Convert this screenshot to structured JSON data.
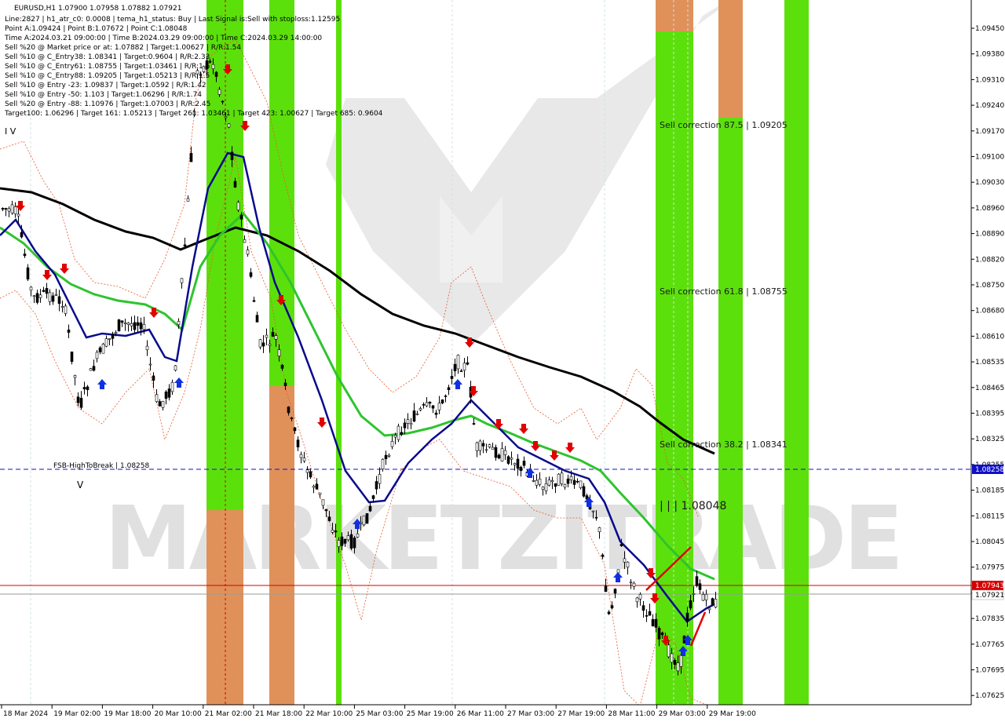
{
  "chart_data": {
    "type": "candlestick",
    "symbol_line": "EURUSD,H1  1.07900 1.07958 1.07882 1.07921",
    "info_lines": [
      "Line:2827  |  h1_atr_c0: 0.0008  |  tema_h1_status: Buy  |  Last Signal is:Sell with stoploss:1.12595",
      "Point A:1.09424  |  Point B:1.07672  |  Point C:1.08048",
      "Time A:2024.03.21 09:00:00  |  Time B:2024.03.29 09:00:00  |  Time C:2024.03.29 14:00:00",
      "Sell %20 @ Market price or at: 1.07882  |  Target:1.00627  |  R/R:1.54",
      "Sell %10 @ C_Entry38: 1.08341  |  Target:0.9604  |  R/R:2.33",
      "Sell %10 @ C_Entry61: 1.08755  |  Target:1.03461  |  R/R:1.6",
      "Sell %10 @ C_Entry88: 1.09205  |  Target:1.05213  |  R/R:1.5",
      "Sell %10 @ Entry -23: 1.09837  |  Target:1.0592  |  R/R:1.42",
      "Sell %10 @ Entry -50: 1.103  |  Target:1.06296  |  R/R:1.74",
      "Sell %20 @ Entry -88: 1.10976  |  Target:1.07003  |  R/R:2.45",
      "Target100: 1.06296  |  Target 161: 1.05213  |  Target 261: 1.03461  |  Target 423: 1.00627  |  Target 685: 0.9604"
    ],
    "y_ticks": [
      "1.09450",
      "1.09380",
      "1.09310",
      "1.09240",
      "1.09170",
      "1.09100",
      "1.09030",
      "1.08960",
      "1.08890",
      "1.08820",
      "1.08750",
      "1.08680",
      "1.08610",
      "1.08535",
      "1.08465",
      "1.08395",
      "1.08325",
      "1.08255",
      "1.08185",
      "1.08115",
      "1.08045",
      "1.07975",
      "1.07905",
      "1.07835",
      "1.07765",
      "1.07695",
      "1.07625"
    ],
    "x_ticks": [
      "18 Mar 2024",
      "19 Mar 02:00",
      "19 Mar 18:00",
      "20 Mar 10:00",
      "21 Mar 02:00",
      "21 Mar 18:00",
      "22 Mar 10:00",
      "25 Mar 03:00",
      "25 Mar 19:00",
      "26 Mar 11:00",
      "27 Mar 03:00",
      "27 Mar 19:00",
      "28 Mar 11:00",
      "29 Mar 03:00",
      "29 Mar 19:00"
    ],
    "price_labels": {
      "fsb_level": "1.08258",
      "red_line": "1.07943",
      "current": "1.07921"
    },
    "annotations": {
      "fsb": "FSB-HighToBreak  |  1.08258",
      "corr_875": "Sell correction 87.5 | 1.09205",
      "corr_618": "Sell correction 61.8 | 1.08755",
      "corr_382": "Sell correction 38.2 | 1.08341",
      "point_c": "| | | 1.08048",
      "wave_iv": "I V",
      "wave_v": "V"
    },
    "watermark": "MARKETZITRADE",
    "colors": {
      "green_zone": "#5ce00c",
      "orange_zone": "#e0915a",
      "fsb_line": "#1010c8",
      "red_line": "#d40000",
      "ma_slow": "#000000",
      "ma_mid": "#2ec42e",
      "tema": "#0a0a8c"
    }
  }
}
